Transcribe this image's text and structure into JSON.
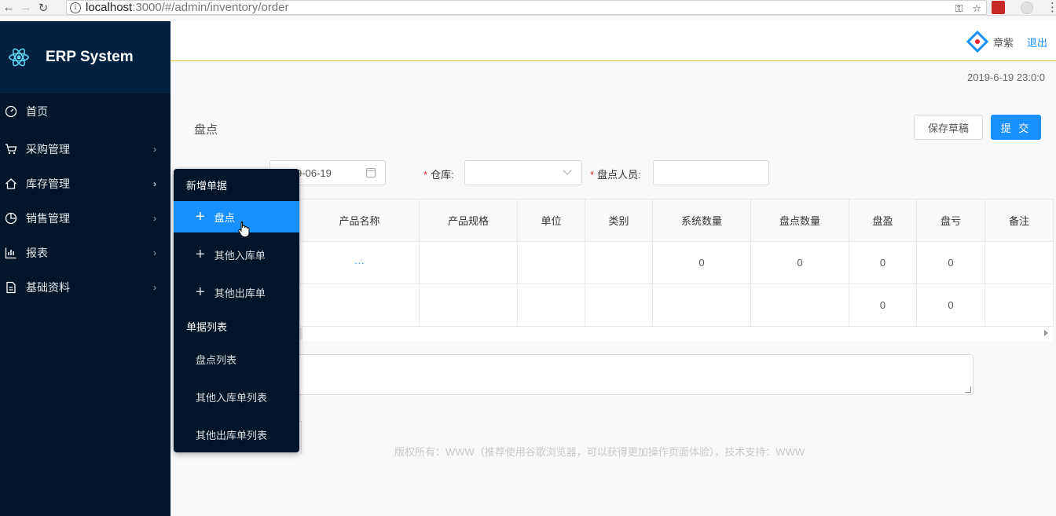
{
  "browser": {
    "url_host": "localhost",
    "url_rest": ":3000/#/admin/inventory/order"
  },
  "app": {
    "title": "ERP System"
  },
  "sidebar": {
    "items": [
      {
        "label": "首页"
      },
      {
        "label": "采购管理"
      },
      {
        "label": "库存管理"
      },
      {
        "label": "销售管理"
      },
      {
        "label": "报表"
      },
      {
        "label": "基础资料"
      }
    ]
  },
  "submenu": {
    "group_new": "新增单据",
    "group_list": "单据列表",
    "items_new": [
      {
        "label": "盘点"
      },
      {
        "label": "其他入库单"
      },
      {
        "label": "其他出库单"
      }
    ],
    "items_list": [
      {
        "label": "盘点列表"
      },
      {
        "label": "其他入库单列表"
      },
      {
        "label": "其他出库单列表"
      }
    ]
  },
  "header": {
    "user_name": "章紫",
    "logout_label": "退出",
    "timestamp": "2019-6-19 23:0:0"
  },
  "page": {
    "title": "盘点",
    "save_draft_label": "保存草稿",
    "submit_label": "提 交"
  },
  "form": {
    "date_value": "9-06-19",
    "warehouse_label": "仓库:",
    "person_label": "盘点人员:"
  },
  "table": {
    "columns": [
      "产品名称",
      "产品规格",
      "单位",
      "类别",
      "系统数量",
      "盘点数量",
      "盘盈",
      "盘亏",
      "备注"
    ],
    "rows": [
      [
        "···",
        "",
        "",
        "",
        "0",
        "0",
        "0",
        "0",
        ""
      ],
      [
        "",
        "",
        "",
        "",
        "",
        "",
        "0",
        "0",
        ""
      ]
    ]
  },
  "footer": {
    "text": "版权所有：WWW（推荐使用谷歌浏览器，可以获得更加操作页面体验），技术支持：WWW"
  },
  "colors": {
    "primary": "#1890ff",
    "sidebar_bg": "#001529",
    "logo_bg": "#002140",
    "required": "#f5222d"
  }
}
